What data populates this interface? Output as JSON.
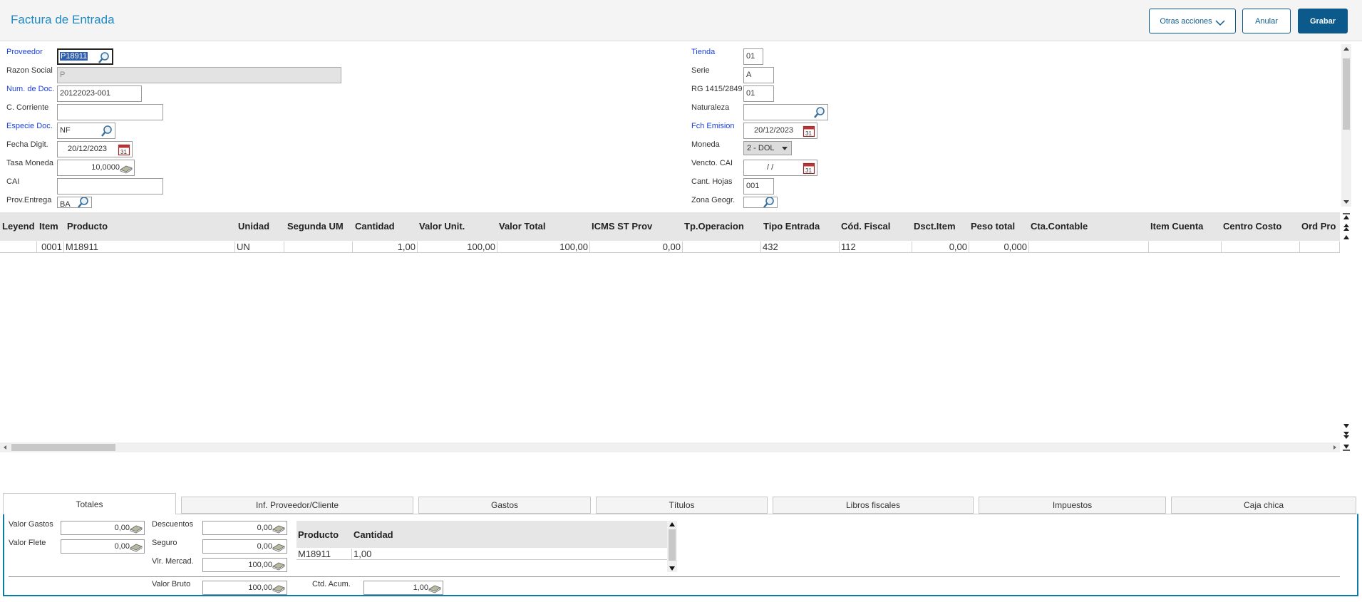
{
  "header": {
    "title": "Factura de Entrada",
    "other_actions": "Otras acciones",
    "cancel": "Anular",
    "save": "Grabar"
  },
  "form": {
    "left": [
      {
        "label": "Proveedor",
        "value": "P18911",
        "icon": "search-icon",
        "link": true
      },
      {
        "label": "Razon Social",
        "value": "P",
        "readonly": true
      },
      {
        "label": "Num. de Doc.",
        "value": "20122023-001",
        "link": true
      },
      {
        "label": "C. Corriente",
        "value": ""
      },
      {
        "label": "Especie Doc.",
        "value": "NF",
        "icon": "search-icon",
        "link": true
      },
      {
        "label": "Fecha Digit.",
        "value": "20/12/2023",
        "icon": "calendar-icon"
      },
      {
        "label": "Tasa Moneda",
        "value": "10,0000",
        "icon": "calculator-icon"
      },
      {
        "label": "CAI",
        "value": ""
      },
      {
        "label": "Prov.Entrega",
        "value": "BA",
        "icon": "search-icon"
      }
    ],
    "right": [
      {
        "label": "Tienda",
        "value": "01",
        "link": true
      },
      {
        "label": "Serie",
        "value": "A"
      },
      {
        "label": "RG 1415/2849",
        "value": "01"
      },
      {
        "label": "Naturaleza",
        "value": "",
        "icon": "search-icon"
      },
      {
        "label": "Fch Emision",
        "value": "20/12/2023",
        "icon": "calendar-icon",
        "link": true
      },
      {
        "label": "Moneda",
        "value": "2 - DOL"
      },
      {
        "label": "Vencto. CAI",
        "value": "/ /",
        "icon": "calendar-icon"
      },
      {
        "label": "Cant. Hojas",
        "value": "001"
      },
      {
        "label": "Zona Geogr.",
        "value": "",
        "icon": "search-icon"
      }
    ]
  },
  "grid": {
    "columns": [
      "Leyend",
      "Item",
      "Producto",
      "Unidad",
      "Segunda UM",
      "Cantidad",
      "Valor Unit.",
      "Valor Total",
      "ICMS ST Prov",
      "Tp.Operacion",
      "Tipo Entrada",
      "Cód. Fiscal",
      "Dsct.Item",
      "Peso total",
      "Cta.Contable",
      "Item Cuenta",
      "Centro Costo",
      "Ord Pro"
    ],
    "rows": [
      [
        "",
        "0001",
        "M18911",
        "UN",
        "",
        "1,00",
        "100,00",
        "100,00",
        "0,00",
        "",
        "432",
        "112",
        "0,00",
        "0,000",
        "",
        "",
        "",
        ""
      ]
    ]
  },
  "tabs": [
    "Totales",
    "Inf. Proveedor/Cliente",
    "Gastos",
    "Títulos",
    "Libros fiscales",
    "Impuestos",
    "Caja chica"
  ],
  "totals": {
    "valor_gastos_label": "Valor Gastos",
    "valor_gastos": "0,00",
    "valor_flete_label": "Valor Flete",
    "valor_flete": "0,00",
    "descuentos_label": "Descuentos",
    "descuentos": "0,00",
    "seguro_label": "Seguro",
    "seguro": "0,00",
    "vlr_mercad_label": "Vlr. Mercad.",
    "vlr_mercad": "100,00",
    "valor_bruto_label": "Valor Bruto",
    "valor_bruto": "100,00",
    "ctd_acum_label": "Ctd. Acum.",
    "ctd_acum": "1,00",
    "mini_grid": {
      "columns": [
        "Producto",
        "Cantidad"
      ],
      "rows": [
        [
          "M18911",
          "1,00"
        ]
      ]
    }
  },
  "colors": {
    "accent": "#0c5a8c",
    "title": "#1d8ac4",
    "link_label": "#1d3fd8",
    "panel_border": "#0e7aa8"
  }
}
